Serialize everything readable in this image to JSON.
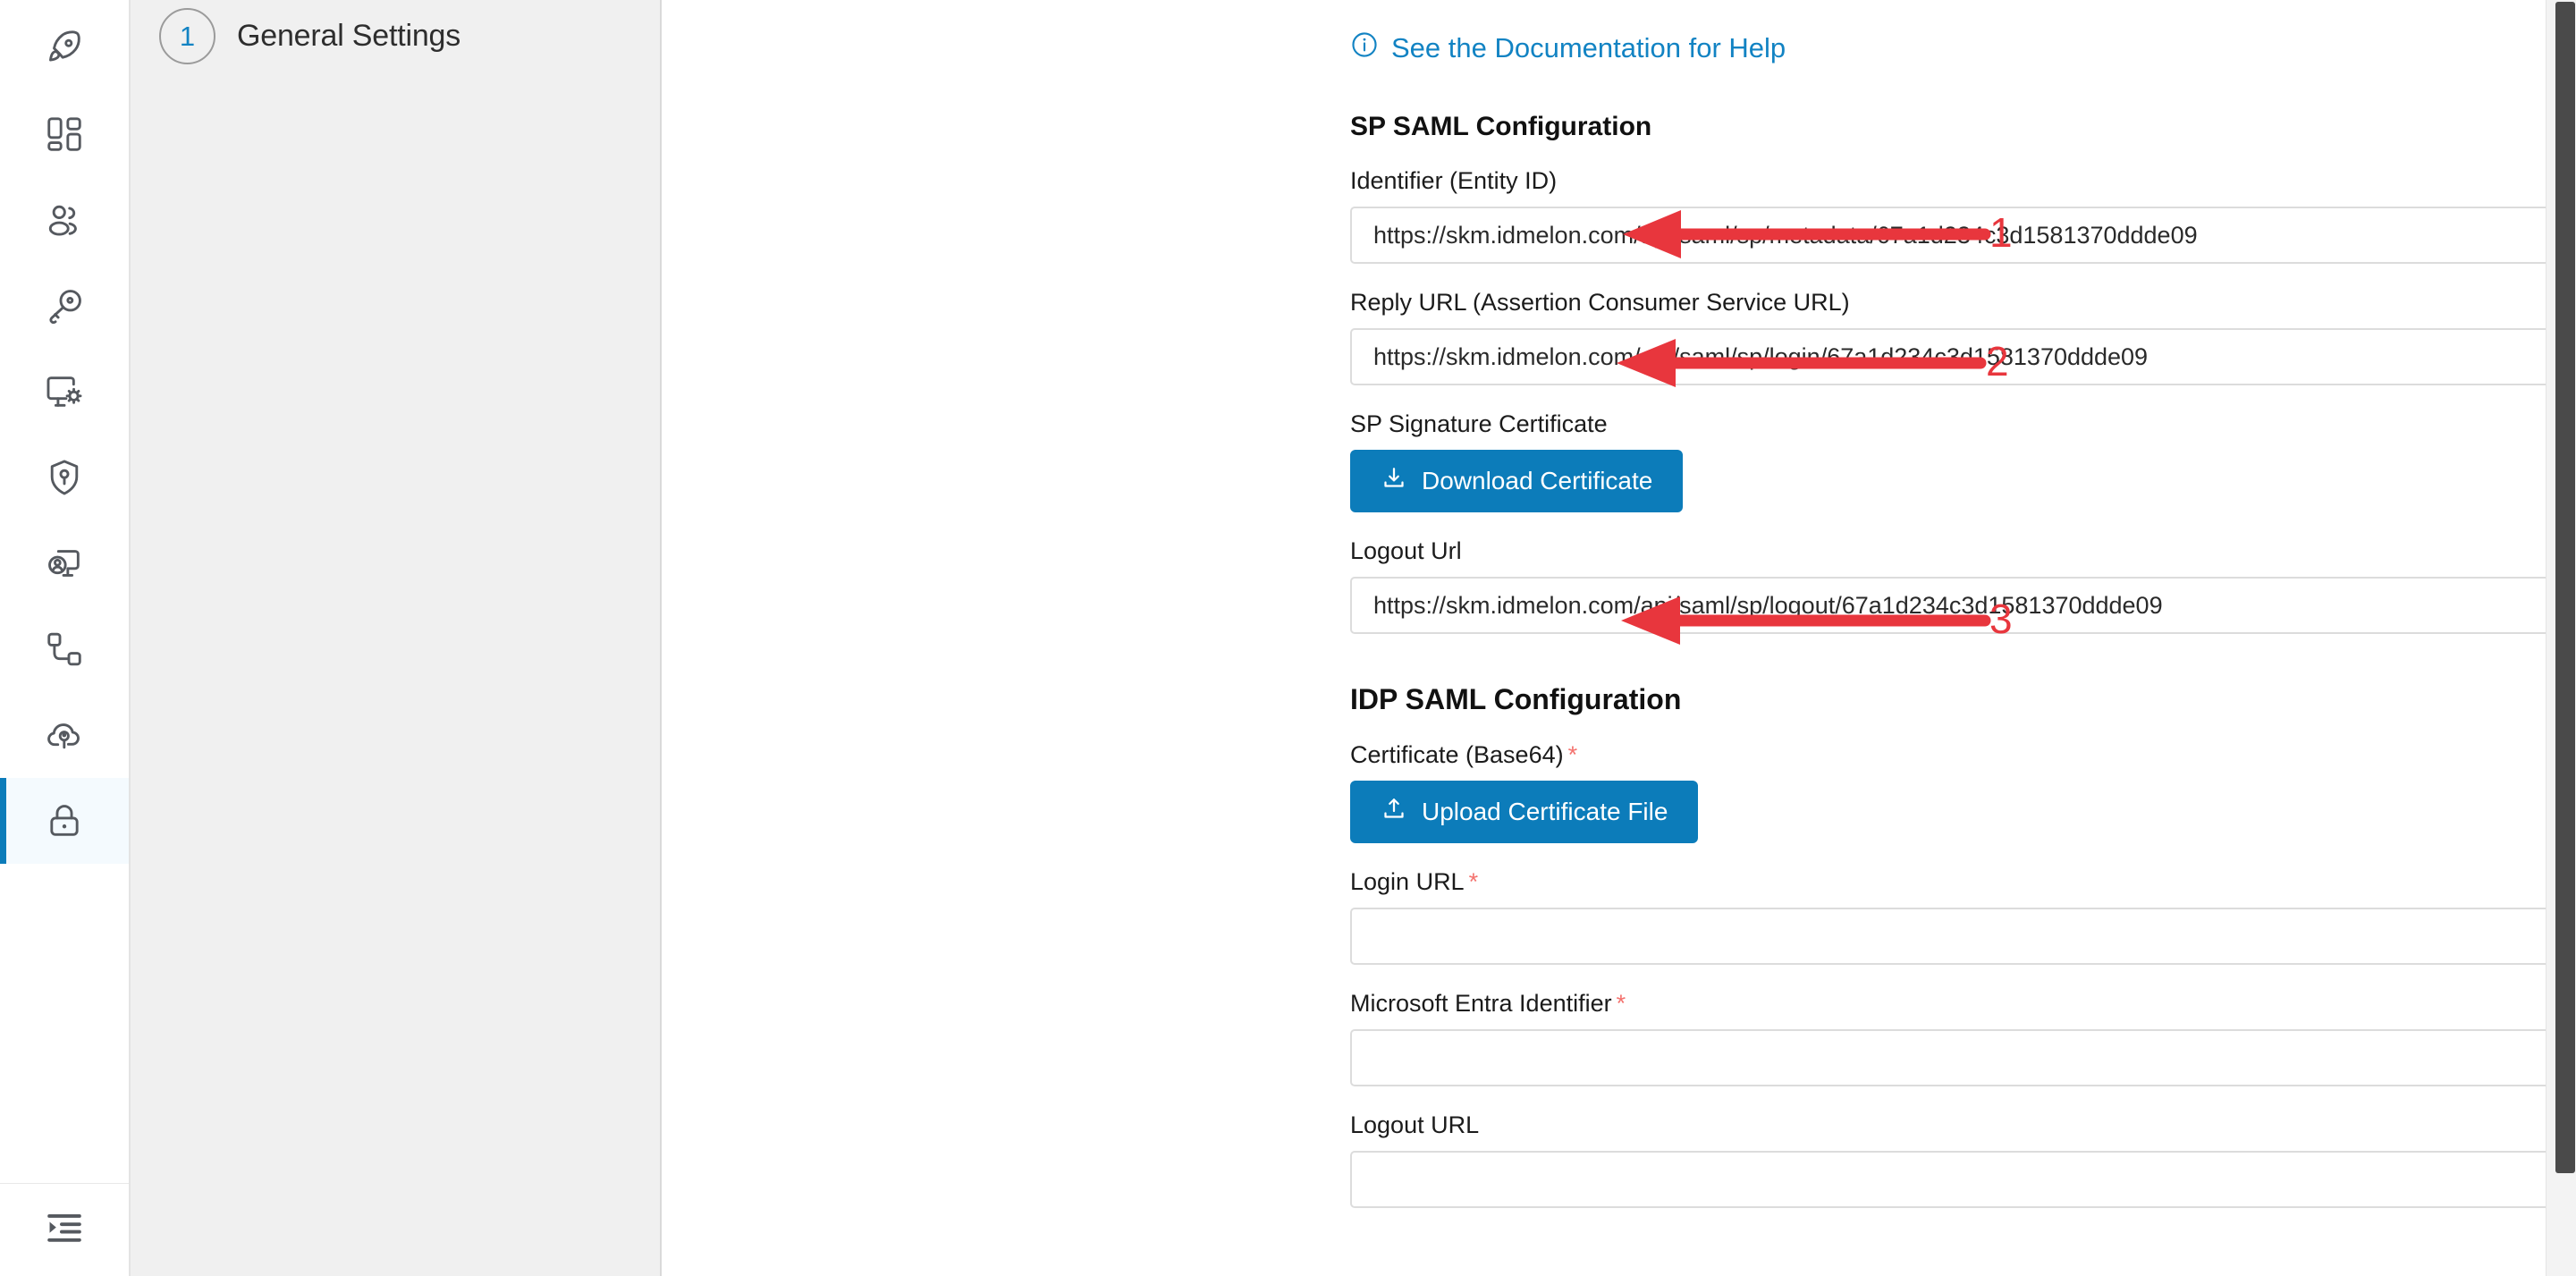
{
  "sidebar": {
    "items": [
      {
        "name": "rocket",
        "icon": "rocket-icon",
        "selected": false
      },
      {
        "name": "dashboard",
        "icon": "dashboard-grid-icon",
        "selected": false
      },
      {
        "name": "users",
        "icon": "users-icon",
        "selected": false
      },
      {
        "name": "keys",
        "icon": "key-icon",
        "selected": false
      },
      {
        "name": "workstations",
        "icon": "monitor-gear-icon",
        "selected": false
      },
      {
        "name": "security",
        "icon": "shield-key-icon",
        "selected": false
      },
      {
        "name": "user-sessions",
        "icon": "monitor-user-icon",
        "selected": false
      },
      {
        "name": "integrations",
        "icon": "nodes-icon",
        "selected": false
      },
      {
        "name": "cloud-keys",
        "icon": "cloud-key-icon",
        "selected": false
      },
      {
        "name": "sso-lock",
        "icon": "lock-icon",
        "selected": true
      }
    ],
    "collapse": {
      "icon": "indent-menu-icon"
    },
    "accent_color": "#0c7cba",
    "selected_bg": "#f4fafe"
  },
  "panel": {
    "step_number": "1",
    "step_label": "General Settings"
  },
  "main": {
    "doc_link": {
      "icon": "info-circle-icon",
      "label": "See the Documentation for Help",
      "color": "#1283c3"
    },
    "sp_section": {
      "title": "SP SAML Configuration",
      "fields": [
        {
          "label": "Identifier (Entity ID)",
          "value": "https://skm.idmelon.com/api/saml/sp/metadata/67a1d234c3d1581370ddde09",
          "placeholder": "",
          "required": false,
          "copy_icon": "copy-documents-icon"
        },
        {
          "label": "Reply URL (Assertion Consumer Service URL)",
          "value": "https://skm.idmelon.com/api/saml/sp/login/67a1d234c3d1581370ddde09",
          "placeholder": "",
          "required": false,
          "copy_icon": "copy-documents-icon"
        }
      ],
      "certificate": {
        "label": "SP Signature Certificate",
        "button_label": "Download Certificate",
        "button_icon": "download-icon"
      },
      "logout_field": {
        "label": "Logout Url",
        "value": "https://skm.idmelon.com/api/saml/sp/logout/67a1d234c3d1581370ddde09",
        "placeholder": "",
        "required": false,
        "copy_icon": "copy-documents-icon"
      }
    },
    "idp_section": {
      "title": "IDP SAML Configuration",
      "certificate": {
        "label": "Certificate (Base64)",
        "required": true,
        "required_mark": "*",
        "button_label": "Upload Certificate File",
        "button_icon": "upload-icon"
      },
      "fields": [
        {
          "label": "Login URL",
          "value": "",
          "placeholder": "",
          "required": true,
          "required_mark": "*",
          "copy_icon": "clipboard-paste-icon"
        },
        {
          "label": "Microsoft Entra Identifier",
          "value": "",
          "placeholder": "",
          "required": true,
          "required_mark": "*",
          "copy_icon": "clipboard-paste-icon"
        },
        {
          "label": "Logout URL",
          "value": "",
          "placeholder": "",
          "required": false,
          "required_mark": "",
          "copy_icon": "clipboard-paste-icon"
        }
      ]
    }
  },
  "annotations": {
    "color": "#e8363d",
    "markers": [
      {
        "number": "1",
        "target": "identifier-entity-id-input"
      },
      {
        "number": "2",
        "target": "reply-url-input"
      },
      {
        "number": "3",
        "target": "logout-url-input"
      }
    ]
  },
  "scrollbar": {
    "thumb_color": "#4a4a4a",
    "track_color": "#f3f3f3"
  }
}
